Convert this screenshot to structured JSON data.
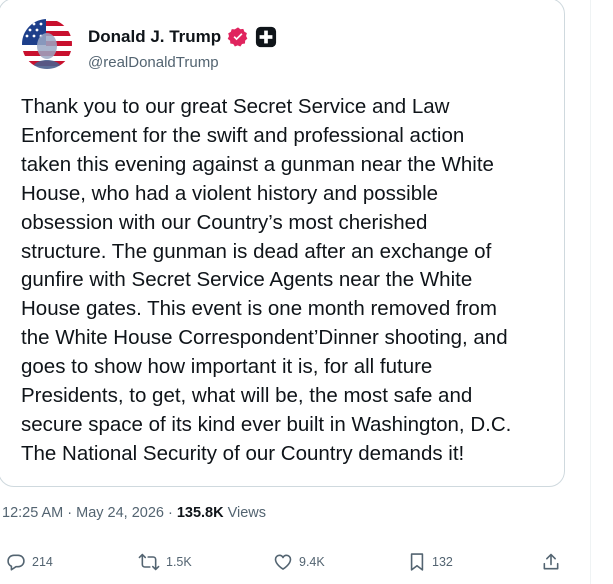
{
  "post": {
    "author": {
      "display_name": "Donald J. Trump",
      "handle": "@realDonaldTrump",
      "verified_badge_icon": "verified-badge-icon",
      "affiliate_badge_icon": "affiliate-badge-icon"
    },
    "text": "Thank you to our great Secret Service and Law\nEnforcement for the swift and professional action\ntaken this evening against a gunman near the White\nHouse, who had a violent history and possible\nobsession with our Country’s most cherished\nstructure. The gunman is dead after an exchange of\ngunfire with Secret Service Agents near the White\nHouse gates. This event is one month removed from\nthe White House Correspondent’Dinner shooting, and\ngoes to show how important it is, for all future\nPresidents, to get, what will be, the most safe and\nsecure space of its kind ever built in Washington, D.C.\nThe National Security of our Country demands it!",
    "time": "12:25 AM",
    "separator": "·",
    "date": "May 24, 2026",
    "views_count": "135.8K",
    "views_label": "Views"
  },
  "actions": {
    "replies": "214",
    "reposts": "1.5K",
    "likes": "9.4K",
    "bookmarks": "132"
  },
  "colors": {
    "text_primary": "#0f1419",
    "text_secondary": "#536471",
    "border": "#cfd9de",
    "badge_pink": "#e0245e"
  }
}
